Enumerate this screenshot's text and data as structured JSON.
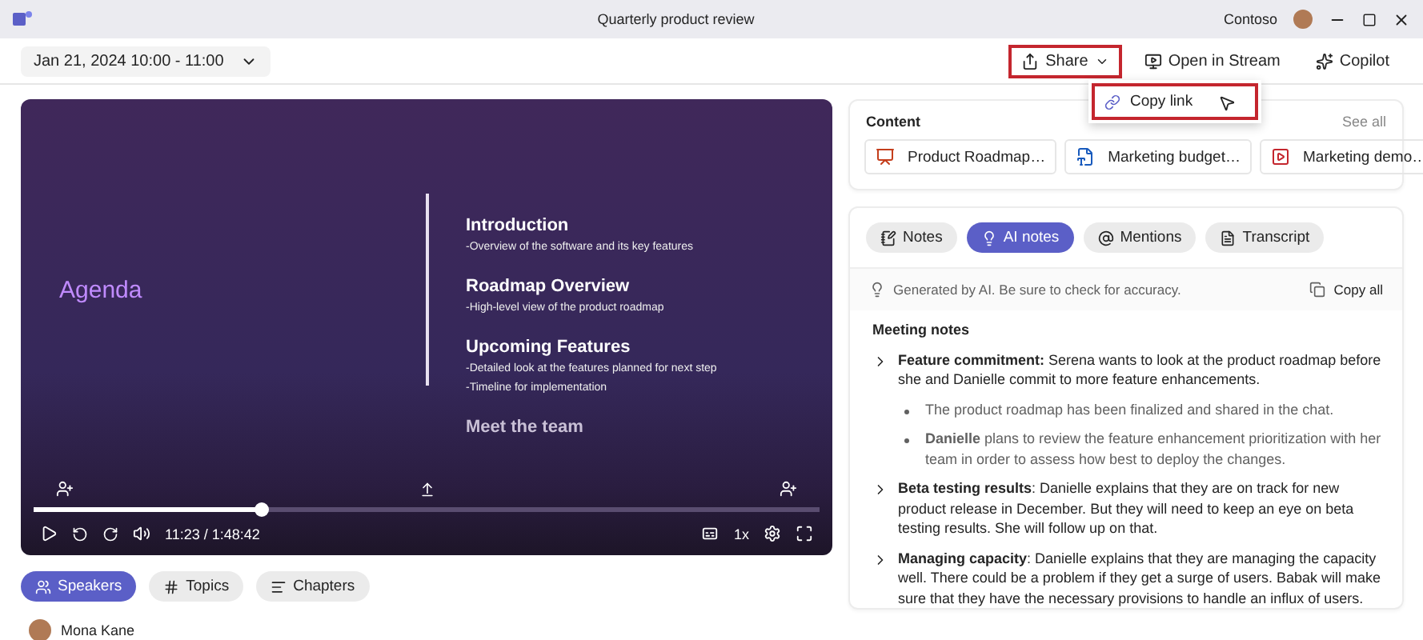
{
  "window": {
    "title": "Quarterly product review",
    "user": "Contoso"
  },
  "toolbar": {
    "date": "Jan 21, 2024 10:00 - 11:00",
    "actions": [
      {
        "label": "Share",
        "kind": "share",
        "highlighted": true
      },
      {
        "label": "Open in Stream",
        "kind": "stream",
        "highlighted": false
      },
      {
        "label": "Copilot",
        "kind": "copilot",
        "highlighted": false
      }
    ]
  },
  "share_menu": {
    "items": [
      {
        "label": "Copy link",
        "highlighted": true
      }
    ]
  },
  "slide": {
    "title": "Agenda",
    "sections": [
      {
        "heading": "Introduction",
        "lines": [
          "-Overview of the software and its key features"
        ]
      },
      {
        "heading": "Roadmap Overview",
        "lines": [
          "-High-level view of the product roadmap"
        ]
      },
      {
        "heading": "Upcoming Features",
        "lines": [
          "-Detailed look at the features planned for next step",
          "-Timeline for implementation"
        ]
      },
      {
        "heading": "Meet the team"
      }
    ]
  },
  "player": {
    "level": 0.29,
    "time": "11:23 / 1:48:42",
    "speed": "1x"
  },
  "left_tabs": [
    {
      "label": "Speakers",
      "kind": "speakers",
      "selected": true
    },
    {
      "label": "Topics",
      "kind": "topics",
      "selected": false
    },
    {
      "label": "Chapters",
      "kind": "chapters",
      "selected": false
    }
  ],
  "speakers": [
    {
      "name": "Mona Kane"
    }
  ],
  "content": {
    "title": "Content",
    "see_all": "See all",
    "files": [
      {
        "name": "Product Roadmap…",
        "kind": "ppt"
      },
      {
        "name": "Marketing budget…",
        "kind": "word"
      },
      {
        "name": "Marketing demo…",
        "kind": "video"
      }
    ]
  },
  "notes_tabs": [
    {
      "label": "Notes",
      "kind": "notes",
      "selected": false
    },
    {
      "label": "AI notes",
      "kind": "ai",
      "selected": true
    },
    {
      "label": "Mentions",
      "kind": "mentions",
      "selected": false
    },
    {
      "label": "Transcript",
      "kind": "transcript",
      "selected": false
    }
  ],
  "ai_banner": "Generated by AI. Be sure to check for accuracy.",
  "copy_all": "Copy all",
  "meeting_notes": {
    "heading": "Meeting notes",
    "items": [
      {
        "text": "**Feature commitment:** Serena wants to look at the product roadmap before she and Danielle commit to more feature enhancements.",
        "children": [
          {
            "text": "The product roadmap has been finalized and shared in the chat."
          },
          {
            "text": "**Danielle** plans to review the feature enhancement prioritization with her team in order to assess how best to deploy the changes."
          }
        ]
      },
      {
        "text": "**Beta testing results**: Danielle explains that they are on track for new product release in December. But they will need to keep an eye on beta testing results. She will follow up on that."
      },
      {
        "text": "**Managing capacity**: Danielle explains that they are managing the capacity well. There could be a problem if they get a surge of users. Babak will make sure that they have the necessary provisions to handle an influx of users."
      }
    ]
  }
}
